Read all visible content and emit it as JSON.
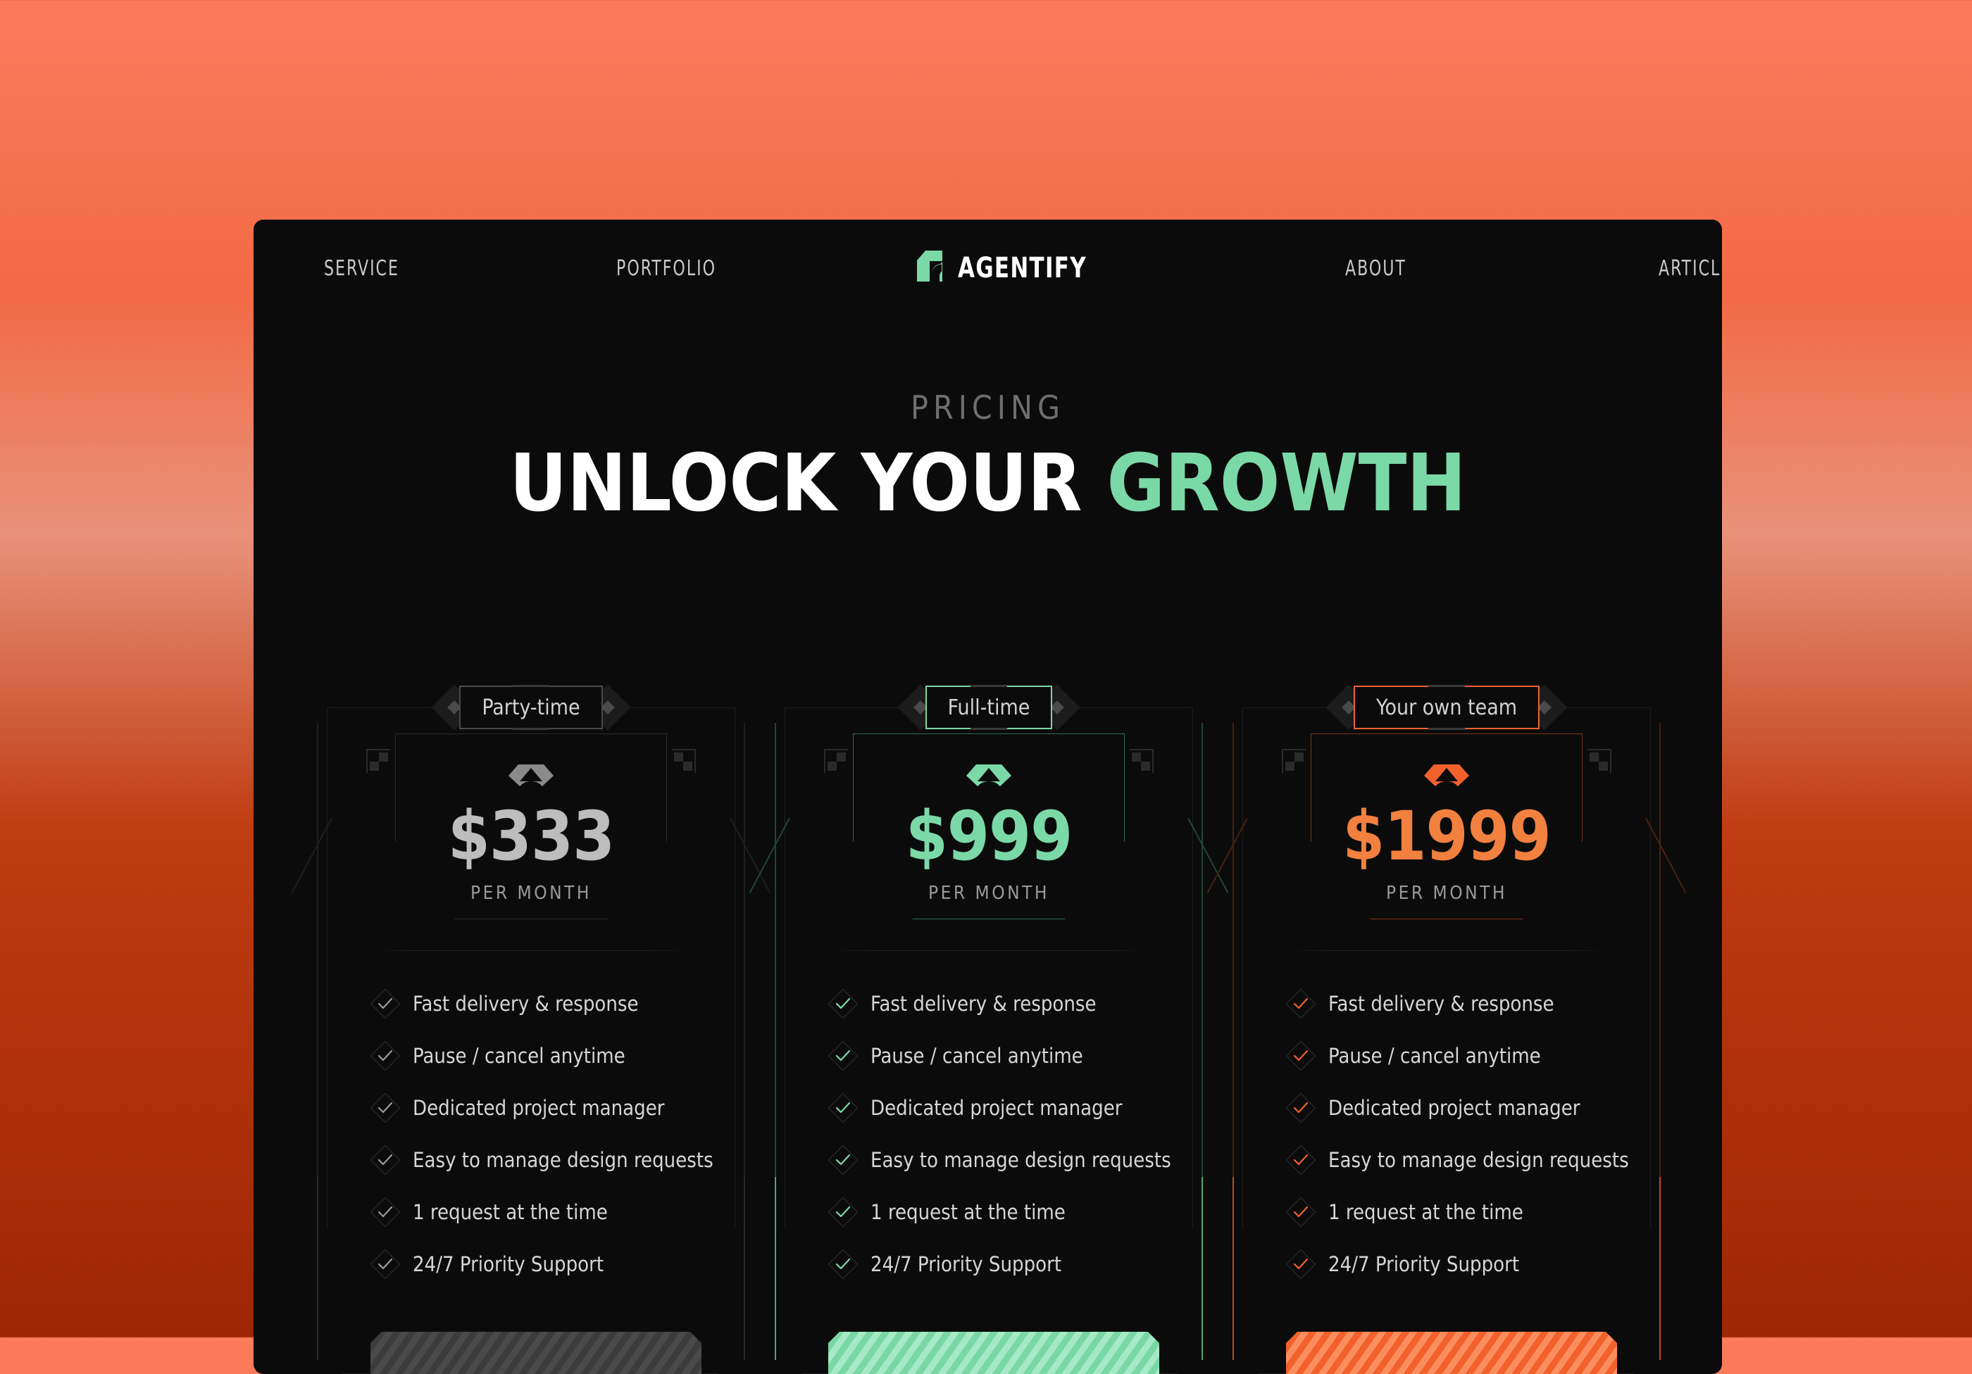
{
  "colors": {
    "page_gradient_top": "#FB7B5B",
    "page_gradient_bottom": "#9E2603",
    "panel_bg": "#0B0B0B",
    "accent_green": "#7BD9A7",
    "accent_orange": "#F2612C",
    "neutral_gray": "#BDBDBD",
    "muted_text": "#9A9A9A"
  },
  "nav": {
    "service": "SERVICE",
    "portfolio": "PORTFOLIO",
    "about": "ABOUT",
    "article": "ARTICLE",
    "brand": "AGENTIFY",
    "brand_icon": "agentify-logo-icon"
  },
  "header": {
    "eyebrow": "PRICING",
    "headline_plain": "UNLOCK YOUR ",
    "headline_accent": "GROWTH"
  },
  "plans": [
    {
      "badge": "Party-time",
      "icon": "gem-plan-icon",
      "price": "$333",
      "period": "PER MONTH",
      "theme": "gray",
      "cta": "",
      "features": [
        "Fast delivery & response",
        "Pause / cancel anytime",
        "Dedicated project manager",
        "Easy to manage design requests",
        "1 request at the time",
        "24/7 Priority Support"
      ]
    },
    {
      "badge": "Full-time",
      "icon": "gem-plan-icon",
      "price": "$999",
      "period": "PER MONTH",
      "theme": "green",
      "cta": "",
      "features": [
        "Fast delivery & response",
        "Pause / cancel anytime",
        "Dedicated project manager",
        "Easy to manage design requests",
        "1 request at the time",
        "24/7 Priority Support"
      ]
    },
    {
      "badge": "Your own team",
      "icon": "gem-plan-icon",
      "price": "$1999",
      "period": "PER MONTH",
      "theme": "orange",
      "cta": "",
      "features": [
        "Fast delivery & response",
        "Pause / cancel anytime",
        "Dedicated project manager",
        "Easy to manage design requests",
        "1 request at the time",
        "24/7 Priority Support"
      ]
    }
  ]
}
